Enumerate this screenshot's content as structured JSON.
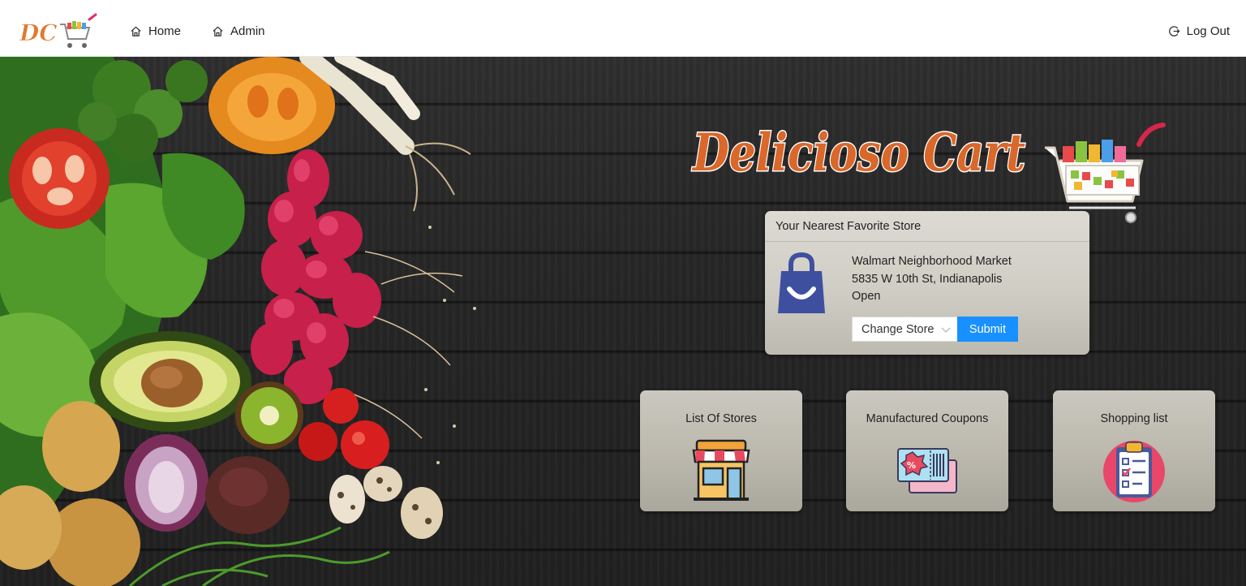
{
  "nav": {
    "logo_text": "DC",
    "home_label": "Home",
    "admin_label": "Admin",
    "logout_label": "Log Out"
  },
  "brand": {
    "title": "Delicioso Cart"
  },
  "store_card": {
    "header": "Your Nearest Favorite Store",
    "store_name": "Walmart Neighborhood Market",
    "store_address": "5835 W 10th St, Indianapolis",
    "store_status": "Open",
    "change_store_label": "Change Store",
    "submit_label": "Submit"
  },
  "tiles": [
    {
      "label": "List Of Stores",
      "icon": "store-icon"
    },
    {
      "label": "Manufactured Coupons",
      "icon": "coupon-icon"
    },
    {
      "label": "Shopping list",
      "icon": "clipboard-icon"
    }
  ],
  "colors": {
    "accent": "#1890ff",
    "brand_orange": "#e07a2e",
    "bag_blue": "#3f4fa0"
  }
}
